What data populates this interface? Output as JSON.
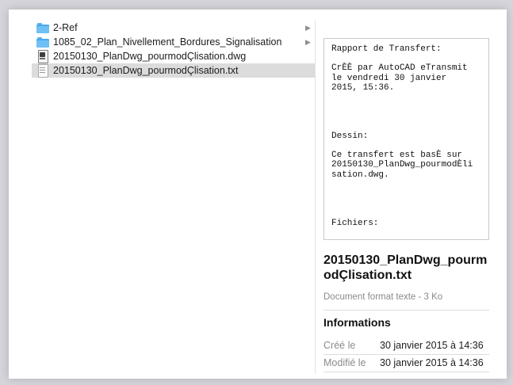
{
  "file_list": {
    "items": [
      {
        "label": "2-Ref",
        "icon": "folder-icon",
        "has_children": true,
        "selected": false
      },
      {
        "label": "1085_02_Plan_Nivellement_Bordures_Signalisation",
        "icon": "folder-icon",
        "has_children": true,
        "selected": false
      },
      {
        "label": "20150130_PlanDwg_pourmodÇlisation.dwg",
        "icon": "dwg-file-icon",
        "has_children": false,
        "selected": false
      },
      {
        "label": "20150130_PlanDwg_pourmodÇlisation.txt",
        "icon": "text-file-icon",
        "has_children": false,
        "selected": true
      }
    ],
    "expand_glyph": "▶"
  },
  "preview": {
    "content": "Rapport de Transfert:\n\nCrÈÈ par AutoCAD eTransmit\nle vendredi 30 janvier\n2015, 15:36.\n\n\n\n\nDessin:\n\nCe transfert est basÈ sur\n20150130_PlanDwg_pourmodÈli\nsation.dwg.\n\n\n\n\nFichiers:"
  },
  "file_info": {
    "name": "20150130_PlanDwg_pourmodÇlisation.txt",
    "kind": "Document format texte - 3 Ko",
    "section_title": "Informations",
    "rows": [
      {
        "key": "Créé le",
        "value": "30 janvier 2015 à 14:36"
      },
      {
        "key": "Modifié le",
        "value": "30 janvier 2015 à 14:36"
      }
    ]
  },
  "colors": {
    "selection": "#dcdcdc",
    "folder": "#4aa8ea",
    "background": "#d6d5db"
  }
}
